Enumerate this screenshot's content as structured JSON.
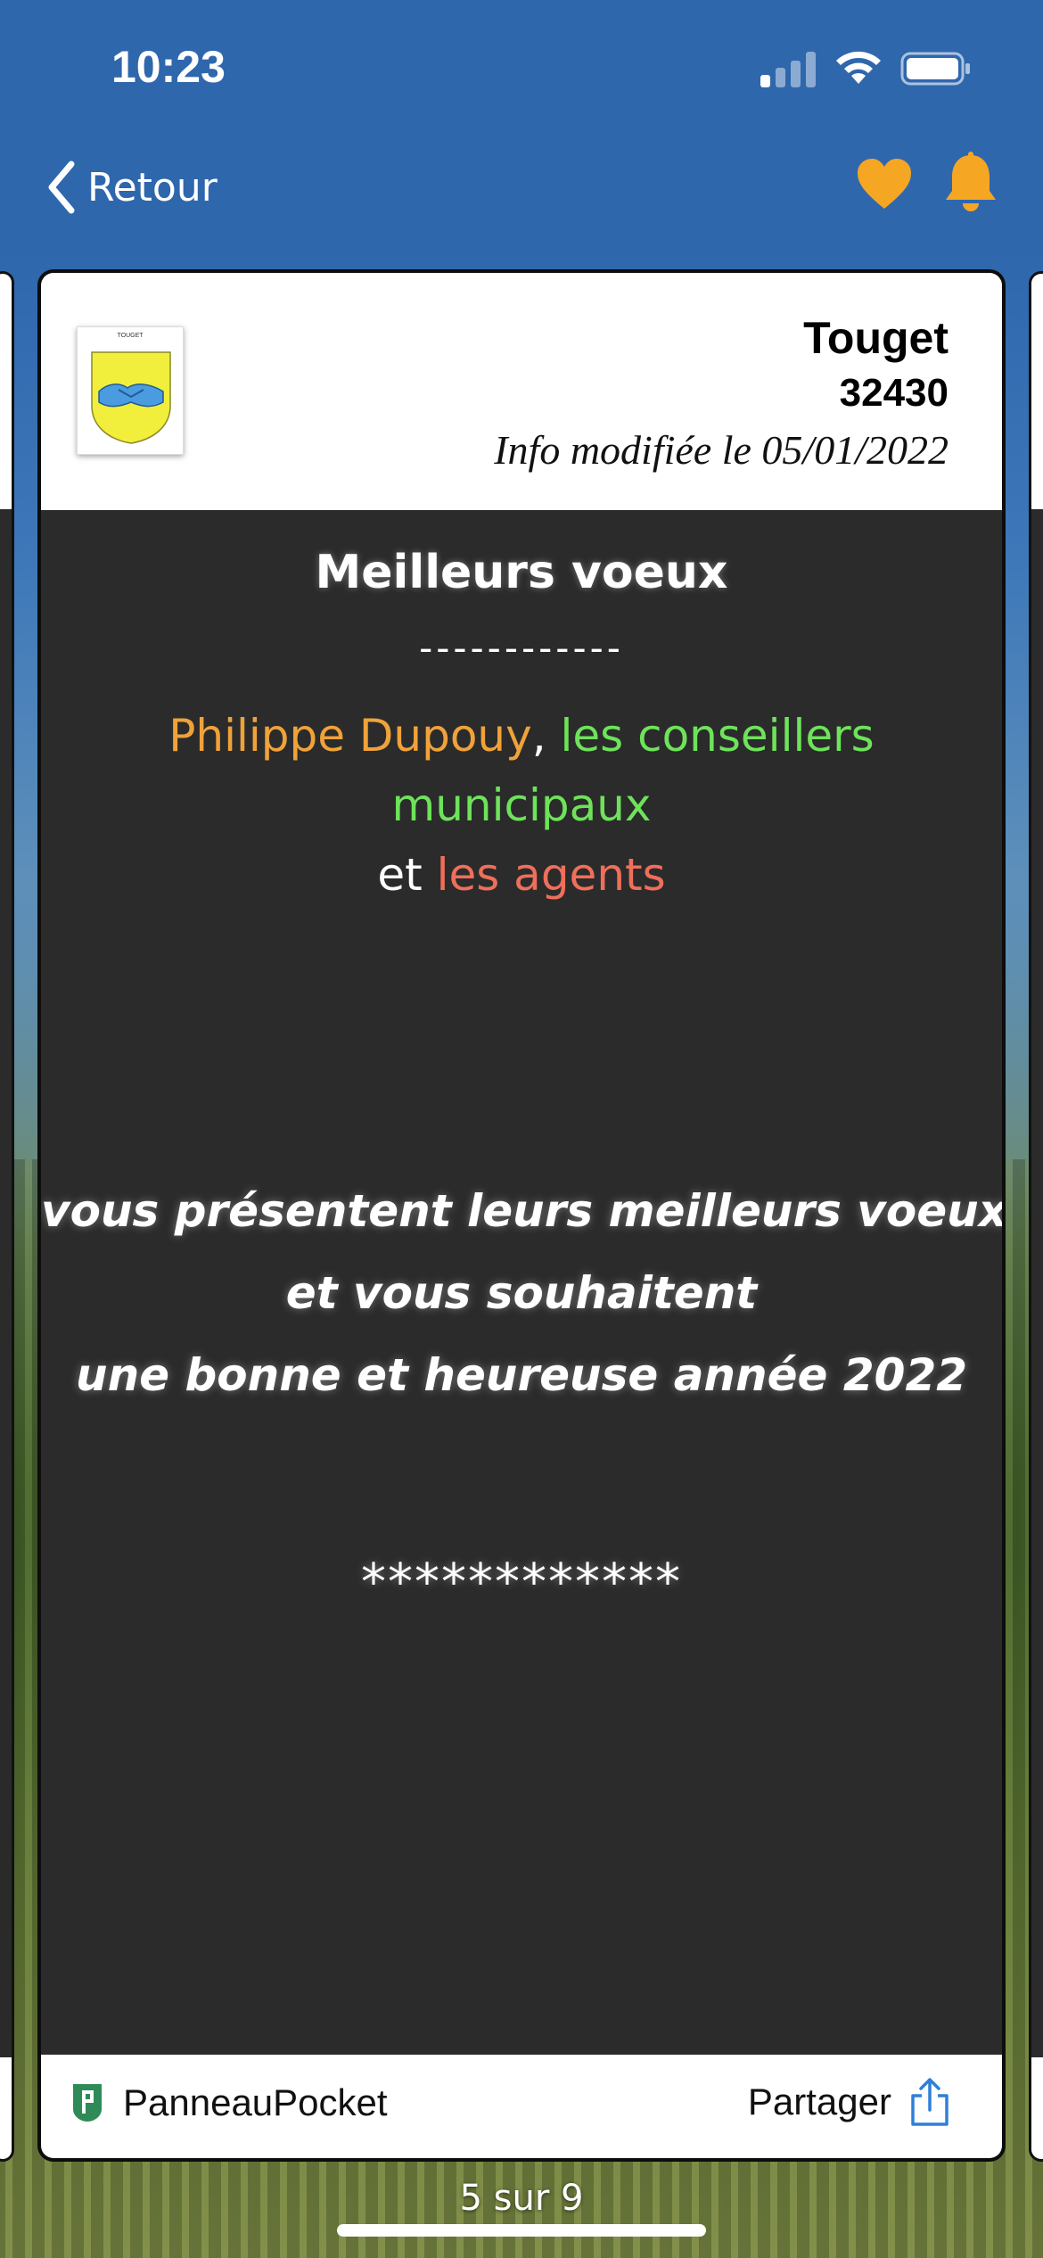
{
  "status_bar": {
    "time": "10:23",
    "signal_bars_active": 1,
    "signal_bars_total": 4
  },
  "nav": {
    "back_label": "Retour",
    "favorite_icon": "heart-icon",
    "notification_icon": "bell-icon",
    "icon_color": "#f5a623"
  },
  "card": {
    "crest_caption": "TOUGET",
    "town": "Touget",
    "postal_code": "32430",
    "modified": "Info modifiée le 05/01/2022",
    "title": "Meilleurs voeux",
    "separator": "------------",
    "authors": {
      "part1": "Philippe Dupouy",
      "sep1": ", ",
      "part2": "les conseillers municipaux",
      "sep2": "et ",
      "part3": "les agents"
    },
    "wishes": [
      "vous présentent leurs meilleurs voeux",
      "et vous souhaitent",
      "une bonne et heureuse année 2022"
    ],
    "stars": "************",
    "colors": {
      "orange": "#f0a23a",
      "green": "#6ee35a",
      "red": "#ef6f5b",
      "body_bg": "#2b2b2b"
    }
  },
  "footer": {
    "brand": "PanneauPocket",
    "share_label": "Partager",
    "share_icon": "share-icon"
  },
  "pager": {
    "label": "5 sur 9",
    "current": 5,
    "total": 9
  }
}
